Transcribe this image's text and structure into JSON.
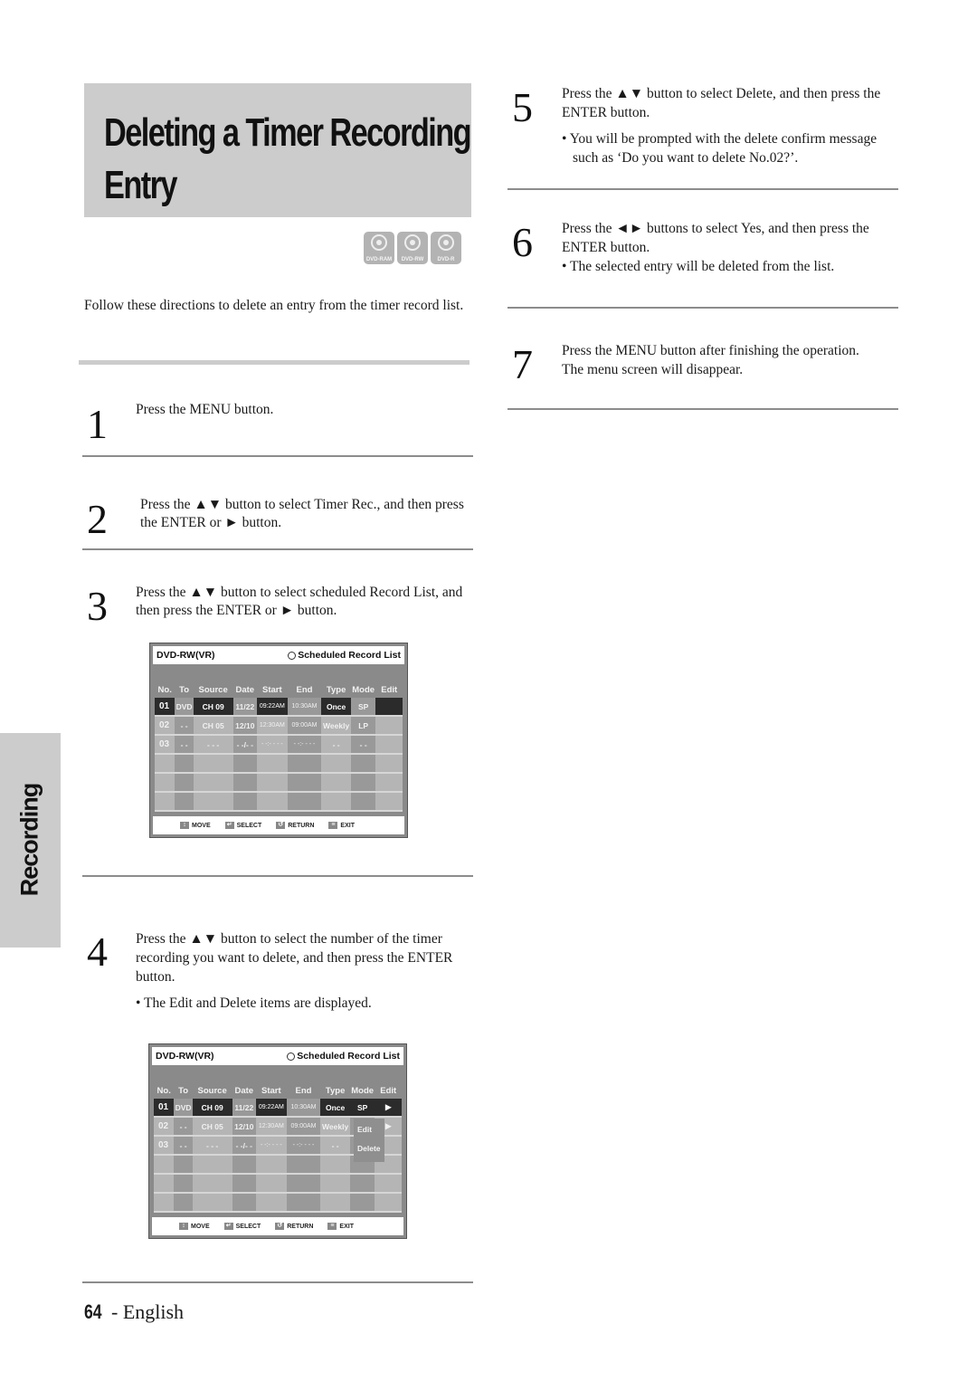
{
  "title": {
    "line1": "Deleting a Timer Recording",
    "line2": "Entry"
  },
  "disc_badges": [
    {
      "icon": "disc-icon",
      "label": "DVD-RAM"
    },
    {
      "icon": "disc-icon",
      "label": "DVD-RW"
    },
    {
      "icon": "disc-icon",
      "label": "DVD-R"
    }
  ],
  "intro": "Follow these directions to delete an entry from the timer record list.",
  "side_tab": "Recording",
  "steps": [
    {
      "num": "1",
      "text": "Press the MENU button."
    },
    {
      "num": "2",
      "text": "Press the ▲▼ button to select Timer Rec., and then press the ENTER or ► button."
    },
    {
      "num": "3",
      "text": "Press the ▲▼ button to select scheduled Record List, and then press the ENTER or ► button."
    },
    {
      "num": "4",
      "text": "Press the ▲▼ button to select the number of the timer recording you want to delete, and then press the ENTER button.",
      "bullet": "• The Edit and Delete items are displayed."
    },
    {
      "num": "5",
      "text": "Press the ▲▼ button to select Delete, and then press the ENTER button.",
      "bullet": "• You will be prompted with the delete confirm message such as ‘Do you want to delete No.02?’."
    },
    {
      "num": "6",
      "text": "Press the ◄► buttons to select Yes, and then press the ENTER button.",
      "bullet": "• The selected entry will be deleted from the list."
    },
    {
      "num": "7",
      "text": "Press the MENU button after finishing the operation. The menu screen will disappear."
    }
  ],
  "osd": {
    "disc_mode": "DVD-RW(VR)",
    "heading": "Scheduled Record List",
    "columns": [
      "No.",
      "To",
      "Source",
      "Date",
      "Start",
      "End",
      "Type",
      "Mode",
      "Edit"
    ],
    "rows": [
      [
        "01",
        "DVD",
        "CH 09",
        "11/22",
        "09:22AM",
        "10:30AM",
        "Once",
        "SP",
        ""
      ],
      [
        "02",
        "- -",
        "CH 05",
        "12/10",
        "12:30AM",
        "09:00AM",
        "Weekly",
        "LP",
        ""
      ],
      [
        "03",
        "- -",
        "- - -",
        "- -/- -",
        "- -:- - - -",
        "- -:- - - -",
        "- -",
        "- -",
        ""
      ],
      [
        "",
        "",
        "",
        "",
        "",
        "",
        "",
        "",
        ""
      ],
      [
        "",
        "",
        "",
        "",
        "",
        "",
        "",
        "",
        ""
      ],
      [
        "",
        "",
        "",
        "",
        "",
        "",
        "",
        "",
        ""
      ]
    ],
    "footer": [
      {
        "icon": "updown-icon",
        "glyph": "↕",
        "label": "MOVE"
      },
      {
        "icon": "enter-icon",
        "glyph": "↵",
        "label": "SELECT"
      },
      {
        "icon": "return-icon",
        "glyph": "↺",
        "label": "RETURN"
      },
      {
        "icon": "menu-icon",
        "glyph": "≡",
        "label": "EXIT"
      }
    ],
    "popup": {
      "edit": "Edit",
      "delete": "Delete",
      "arrow": "▶"
    }
  },
  "footer": {
    "page": "64",
    "sep": " - ",
    "lang": "English"
  }
}
